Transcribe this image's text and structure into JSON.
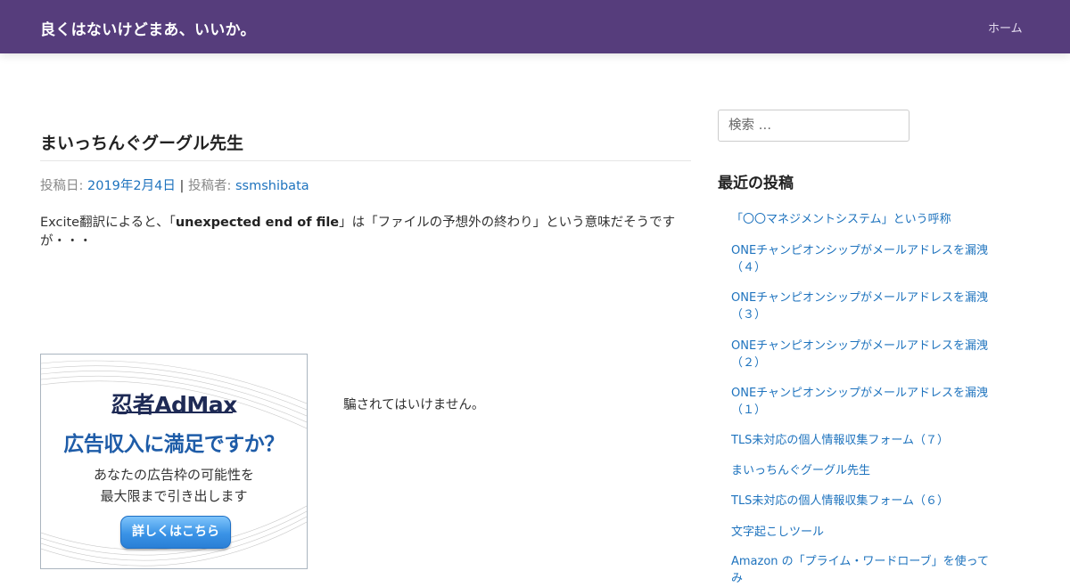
{
  "colors": {
    "header_bg": "#563d7c",
    "link": "#1e73be",
    "ad_accent": "#1e5ca8"
  },
  "header": {
    "site_title": "良くはないけどまあ、いいか。",
    "nav": [
      "ホーム"
    ]
  },
  "post": {
    "title": "まいっちんぐグーグル先生",
    "meta": {
      "date_label": "投稿日:",
      "date": "2019年2月4日",
      "separator": "|",
      "author_label": "投稿者:",
      "author": "ssmshibata"
    },
    "body": {
      "before": "Excite翻訳によると、「",
      "strong": "unexpected end of file",
      "after": "」は「ファイルの予想外の終わり」という意味だそうですが・・・"
    }
  },
  "ad": {
    "logo": "忍者AdMax",
    "headline": "広告収入に満足ですか？",
    "sub_line1": "あなたの広告枠の可能性を",
    "sub_line2": "最大限まで引き出します",
    "button": "詳しくはこちら"
  },
  "side_note": "騙されてはいけません。",
  "sidebar": {
    "search_placeholder": "検索 …",
    "recent_title": "最近の投稿",
    "recent_posts": [
      "「〇〇マネジメントシステム」という呼称",
      "ONEチャンピオンシップがメールアドレスを漏洩（４）",
      "ONEチャンピオンシップがメールアドレスを漏洩（３）",
      "ONEチャンピオンシップがメールアドレスを漏洩（２）",
      "ONEチャンピオンシップがメールアドレスを漏洩（１）",
      "TLS未対応の個人情報収集フォーム（７）",
      "まいっちんぐグーグル先生",
      "TLS未対応の個人情報収集フォーム（６）",
      "文字起こしツール",
      "Amazon の「プライム・ワードローブ」を使ってみ"
    ]
  }
}
